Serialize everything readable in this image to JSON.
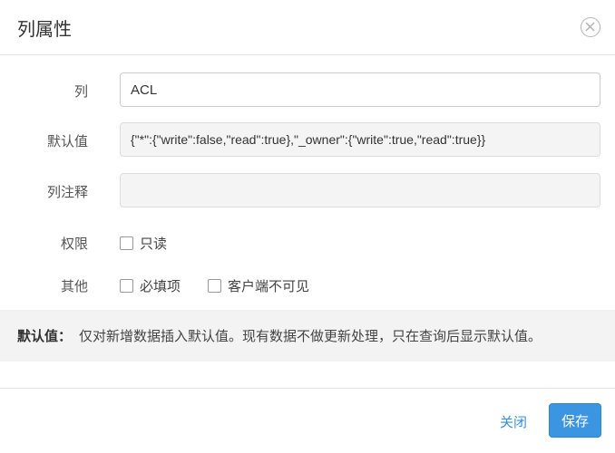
{
  "dialog": {
    "title": "列属性",
    "close_icon": "close-icon"
  },
  "form": {
    "column": {
      "label": "列",
      "value": "ACL"
    },
    "default_value": {
      "label": "默认值",
      "value": "{\"*\":{\"write\":false,\"read\":true},\"_owner\":{\"write\":true,\"read\":true}}"
    },
    "comment": {
      "label": "列注释",
      "value": ""
    },
    "permission": {
      "label": "权限",
      "options": [
        {
          "label": "只读",
          "checked": false
        }
      ]
    },
    "other": {
      "label": "其他",
      "options": [
        {
          "label": "必填项",
          "checked": false
        },
        {
          "label": "客户端不可见",
          "checked": false
        }
      ]
    }
  },
  "note": {
    "key": "默认值：",
    "text": "仅对新增数据插入默认值。现有数据不做更新处理，只在查询后显示默认值。"
  },
  "footer": {
    "close_label": "关闭",
    "save_label": "保存"
  },
  "colors": {
    "primary": "#3c95e0",
    "link": "#3a8fd9",
    "note_bg": "#f3f3f3"
  }
}
